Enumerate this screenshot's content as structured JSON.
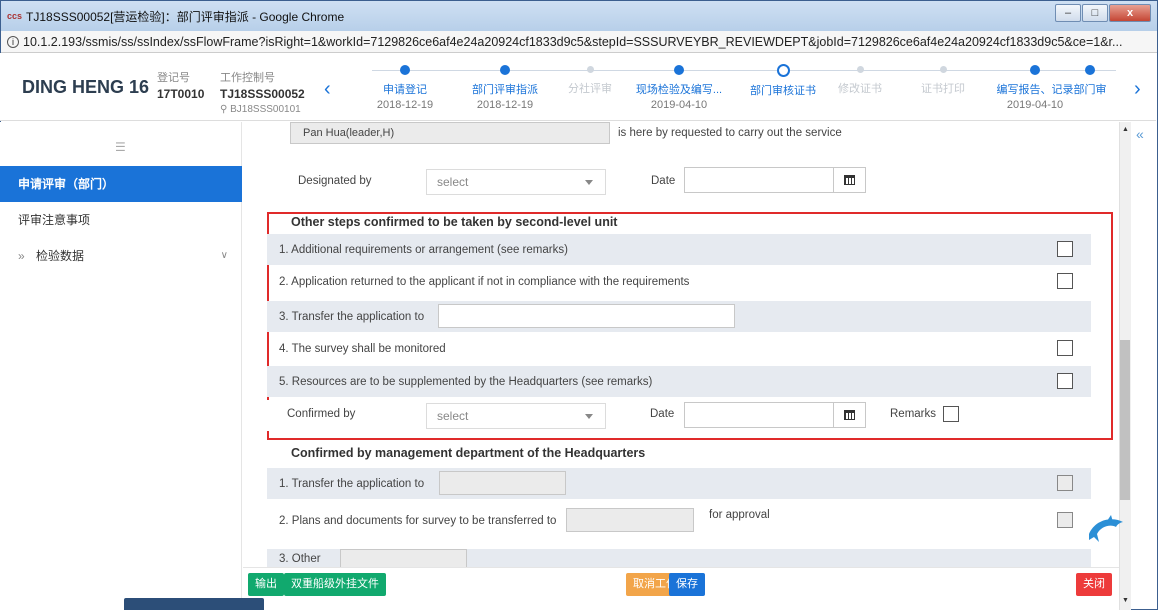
{
  "window": {
    "app_icon": "ccs",
    "title": "TJ18SSS00052[营运检验]：部门评审指派 - Google Chrome",
    "minimize_glyph": "–",
    "maximize_glyph": "□",
    "close_glyph": "x"
  },
  "address": {
    "url": "10.1.2.193/ssmis/ss/ssIndex/ssFlowFrame?isRight=1&workId=7129826ce6af4e24a20924cf1833d9c5&stepId=SSSURVEYBR_REVIEWDEPT&jobId=7129826ce6af4e24a20924cf1833d9c5&ce=1&r..."
  },
  "header": {
    "brand": "DING HENG 16",
    "reg_label": "登记号",
    "reg_value": "17T0010",
    "work_label": "工作控制号",
    "work_value": "TJ18SSS00052",
    "work_sub": "BJ18SSS00101"
  },
  "steps": [
    {
      "name": "申请登记",
      "date": "2018-12-19",
      "state": "done"
    },
    {
      "name": "部门评审指派",
      "date": "2018-12-19",
      "state": "done"
    },
    {
      "name": "分社评审",
      "date": "",
      "state": "pending"
    },
    {
      "name": "现场检验及编写...",
      "date": "2019-04-10",
      "state": "done"
    },
    {
      "name": "部门审核证书",
      "date": "",
      "state": "current"
    },
    {
      "name": "修改证书",
      "date": "",
      "state": "pending"
    },
    {
      "name": "证书打印",
      "date": "",
      "state": "pending"
    },
    {
      "name": "编写报告、记录",
      "date": "2019-04-10",
      "state": "done"
    },
    {
      "name": "部门审",
      "date": "",
      "state": "done"
    }
  ],
  "sidebar": {
    "items": [
      {
        "label": "申请评审（部门）",
        "active": true
      },
      {
        "label": "评审注意事项",
        "active": false
      },
      {
        "label": "检验数据",
        "active": false
      }
    ]
  },
  "form": {
    "leader_value": "Pan Hua(leader,H)",
    "service_text": "is here by requested to carry out the service",
    "designated_by_label": "Designated by",
    "designated_select": "select",
    "date_label": "Date",
    "second_level_title": "Other steps confirmed to be taken by second-level unit",
    "second_level_items": [
      "1. Additional requirements or arrangement (see remarks)",
      "2. Application returned to the applicant if not in compliance with the requirements",
      "3. Transfer the application to",
      "4. The survey shall be monitored",
      "5. Resources are to be supplemented by the Headquarters (see remarks)"
    ],
    "confirmed_by_label": "Confirmed by",
    "confirmed_select": "select",
    "confirmed_date_label": "Date",
    "remarks_label": "Remarks",
    "hq_title": "Confirmed by management department of the Headquarters",
    "hq_items": [
      "1. Transfer the application to",
      "2. Plans and documents for survey to be transferred to",
      "3. Other"
    ],
    "for_approval": "for approval"
  },
  "buttons": {
    "export": "输出",
    "dual_class": "双重船级外挂文件",
    "cancel_work": "取消工作",
    "save": "保存",
    "close": "关闭"
  },
  "colors": {
    "primary": "#1a73d8",
    "red_outline": "#e02a2a",
    "green": "#11a96e",
    "orange": "#f2a54a",
    "danger": "#ed3b3b"
  }
}
